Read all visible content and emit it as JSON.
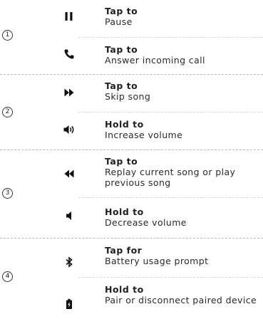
{
  "groups": [
    {
      "number": "1",
      "items": [
        {
          "icon": "pause-icon",
          "lead": "Tap to",
          "desc": "Pause"
        },
        {
          "icon": "phone-icon",
          "lead": "Tap to",
          "desc": "Answer incoming call"
        }
      ]
    },
    {
      "number": "2",
      "items": [
        {
          "icon": "fast-forward-icon",
          "lead": "Tap to",
          "desc": "Skip song"
        },
        {
          "icon": "volume-up-icon",
          "lead": "Hold to",
          "desc": "Increase volume"
        }
      ]
    },
    {
      "number": "3",
      "items": [
        {
          "icon": "rewind-icon",
          "lead": "Tap to",
          "desc": "Replay current song or play previous song"
        },
        {
          "icon": "volume-down-icon",
          "lead": "Hold to",
          "desc": "Decrease volume"
        }
      ]
    },
    {
      "number": "4",
      "items": [
        {
          "icon": "bluetooth-icon",
          "lead": "Tap for",
          "desc": "Battery usage prompt"
        },
        {
          "icon": "battery-icon",
          "lead": "Hold to",
          "desc": "Pair or disconnect paired device"
        }
      ]
    }
  ]
}
